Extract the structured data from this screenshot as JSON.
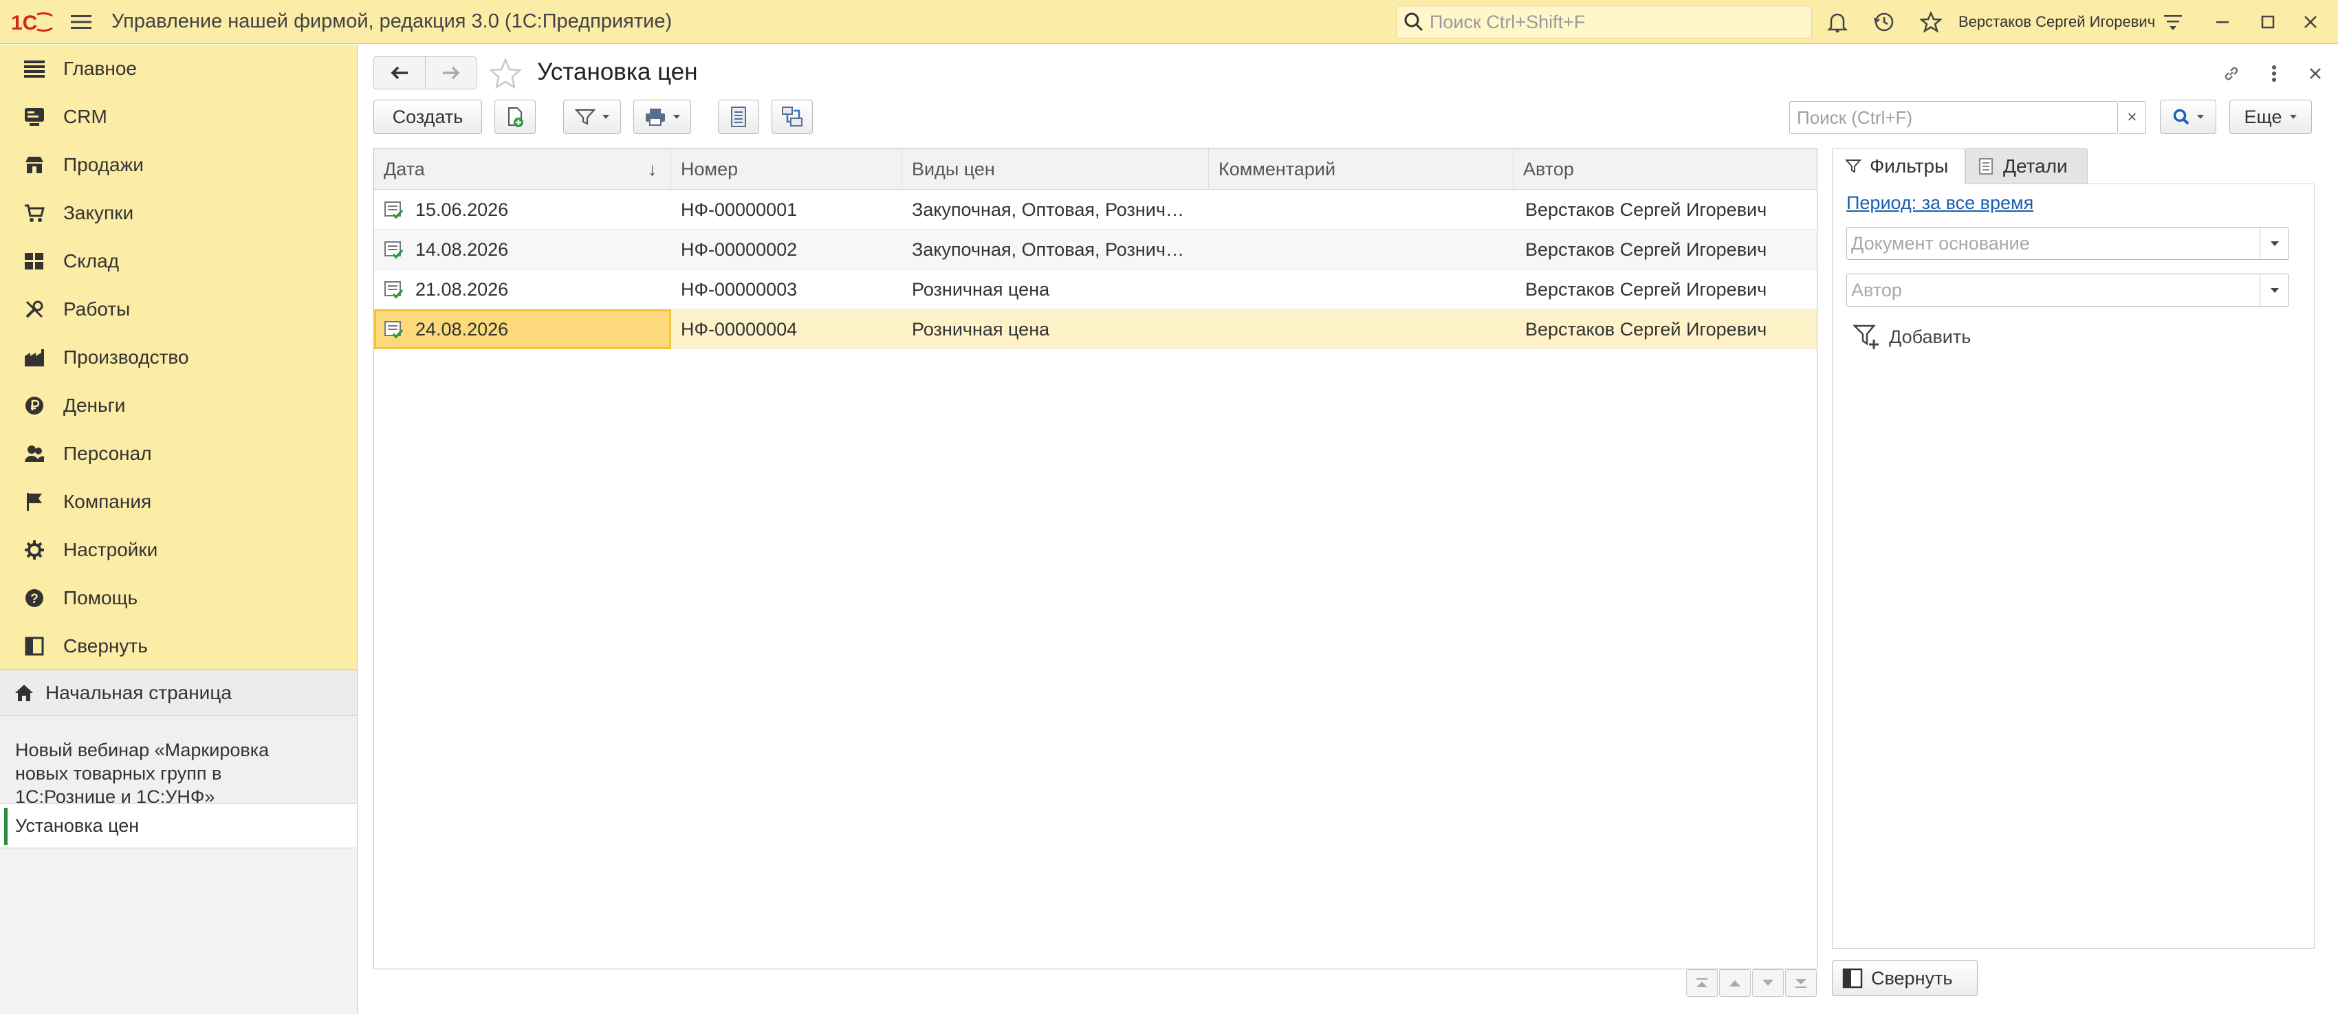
{
  "titlebar": {
    "logo_text": "1С",
    "app_title": "Управление нашей фирмой, редакция 3.0  (1С:Предприятие)",
    "search_placeholder": "Поиск Ctrl+Shift+F",
    "user_name": "Верстаков Сергей Игоревич",
    "icons": [
      "menu-icon",
      "search-icon",
      "bell-icon",
      "history-icon",
      "star-icon",
      "settings-icon",
      "minimize-icon",
      "maximize-icon",
      "close-icon"
    ]
  },
  "sidebar": {
    "sections": [
      {
        "label": "Главное",
        "icon": "list-icon"
      },
      {
        "label": "CRM",
        "icon": "crm-icon"
      },
      {
        "label": "Продажи",
        "icon": "shop-icon"
      },
      {
        "label": "Закупки",
        "icon": "cart-icon"
      },
      {
        "label": "Склад",
        "icon": "warehouse-icon"
      },
      {
        "label": "Работы",
        "icon": "tools-icon"
      },
      {
        "label": "Производство",
        "icon": "factory-icon"
      },
      {
        "label": "Деньги",
        "icon": "ruble-icon"
      },
      {
        "label": "Персонал",
        "icon": "people-icon"
      },
      {
        "label": "Компания",
        "icon": "flag-icon"
      },
      {
        "label": "Настройки",
        "icon": "gear-icon"
      },
      {
        "label": "Помощь",
        "icon": "help-icon"
      },
      {
        "label": "Свернуть",
        "icon": "collapse-panel-icon"
      }
    ],
    "home": "Начальная страница",
    "webinar_lines": [
      "Новый вебинар «Маркировка",
      "новых товарных групп в",
      "1С:Рознице и 1С:УНФ»"
    ],
    "open_doc": "Установка цен"
  },
  "main": {
    "title": "Установка цен",
    "toolbar": {
      "create_label": "Создать",
      "search_placeholder": "Поиск (Ctrl+F)",
      "clear_label": "×",
      "more_label": "Еще"
    },
    "table": {
      "columns": [
        "Дата",
        "Номер",
        "Виды цен",
        "Комментарий",
        "Автор"
      ],
      "sort_indicator": "↓",
      "rows": [
        {
          "date": "15.06.2026",
          "number": "НФ-00000001",
          "price_types": "Закупочная, Оптовая, Рознич…",
          "comment": "",
          "author": "Верстаков Сергей Игоревич"
        },
        {
          "date": "14.08.2026",
          "number": "НФ-00000002",
          "price_types": "Закупочная, Оптовая, Рознич…",
          "comment": "",
          "author": "Верстаков Сергей Игоревич"
        },
        {
          "date": "21.08.2026",
          "number": "НФ-00000003",
          "price_types": "Розничная цена",
          "comment": "",
          "author": "Верстаков Сергей Игоревич"
        },
        {
          "date": "24.08.2026",
          "number": "НФ-00000004",
          "price_types": "Розничная цена",
          "comment": "",
          "author": "Верстаков Сергей Игоревич"
        }
      ],
      "selected_row": 3
    }
  },
  "filters_panel": {
    "tab_filters": "Фильтры",
    "tab_details": "Детали",
    "period_link": "Период: за все время",
    "basis_placeholder": "Документ основание",
    "author_placeholder": "Автор",
    "add_label": "Добавить",
    "collapse_label": "Свернуть"
  },
  "colors": {
    "accent_yellow": "#fbeda7",
    "logo_red": "#d6261c",
    "link_blue": "#1a5fb0",
    "selection": "#fcd97a",
    "selected_row": "#fdf2c8",
    "doc_green": "#2e9b3e"
  }
}
